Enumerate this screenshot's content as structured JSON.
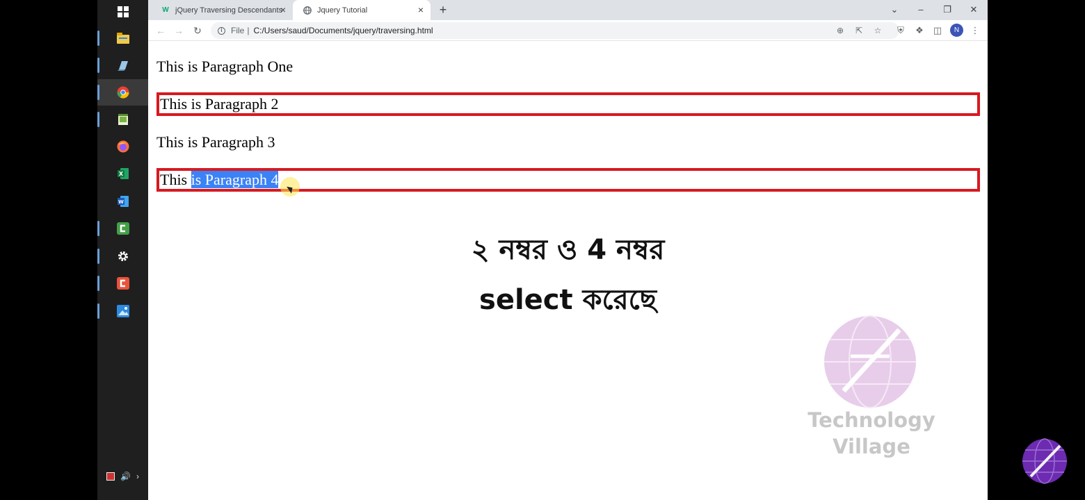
{
  "taskbar": {
    "items": [
      {
        "name": "windows-start-icon",
        "color": "#ffffff"
      },
      {
        "name": "file-explorer-icon",
        "color": "#f2c94c"
      },
      {
        "name": "notepad-icon",
        "color": "#7fb3d5"
      },
      {
        "name": "chrome-icon",
        "color": "#e94235"
      },
      {
        "name": "notepad-plus-plus-icon",
        "color": "#7cb342"
      },
      {
        "name": "firefox-icon",
        "color": "#ff7139"
      },
      {
        "name": "excel-icon",
        "color": "#1d6f42"
      },
      {
        "name": "word-icon",
        "color": "#2b579a"
      },
      {
        "name": "camtasia-icon",
        "color": "#4caf50"
      },
      {
        "name": "settings-icon",
        "color": "#ffffff"
      },
      {
        "name": "camtasia-recorder-icon",
        "color": "#e8533b"
      },
      {
        "name": "photos-icon",
        "color": "#2d8ae0"
      }
    ]
  },
  "browser": {
    "tabs": [
      {
        "title": "jQuery Traversing Descendants",
        "favicon": "W",
        "active": false
      },
      {
        "title": "Jquery Tutorial",
        "favicon": "globe",
        "active": true
      }
    ],
    "address": {
      "scheme": "File",
      "url": "C:/Users/saud/Documents/jquery/traversing.html"
    },
    "profile_initial": "N"
  },
  "page": {
    "p1": "This is Paragraph One",
    "p2": "This is Paragraph 2",
    "p3": "This is Paragraph 3",
    "p4_prefix": "This ",
    "p4_selected": "is Paragraph 4",
    "highlight_color": "#d71920",
    "selection_color": "#3b82f6"
  },
  "caption": {
    "line1": "২ নম্বর ও 4 নম্বর",
    "line2": "select করেছে"
  },
  "watermark": {
    "line1": "Technology",
    "line2": "Village"
  }
}
